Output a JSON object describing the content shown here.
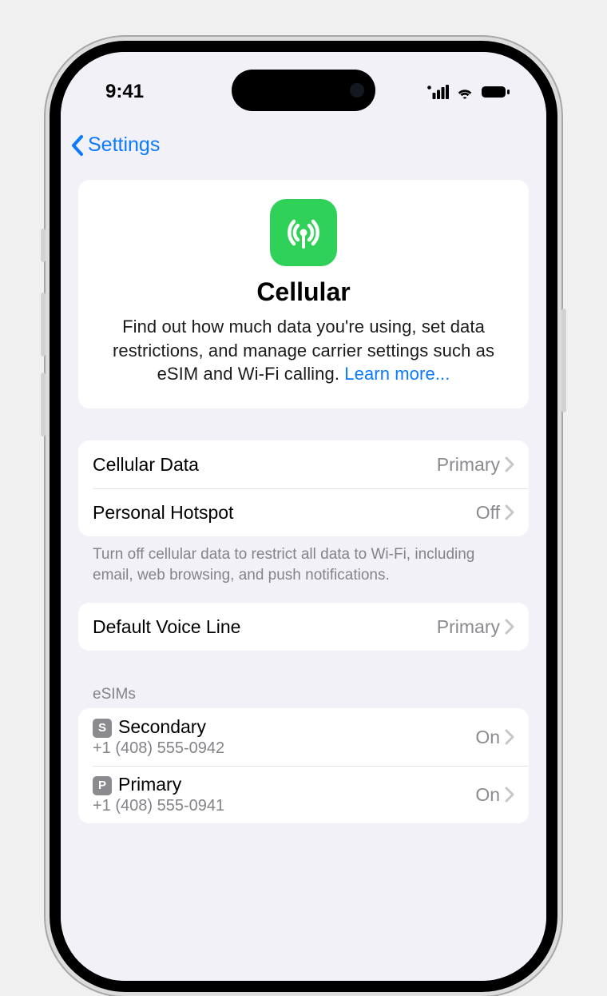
{
  "status": {
    "time": "9:41"
  },
  "nav": {
    "back_label": "Settings"
  },
  "hero": {
    "title": "Cellular",
    "description": "Find out how much data you're using, set data restrictions, and manage carrier settings such as eSIM and Wi-Fi calling. ",
    "learn_more": "Learn more..."
  },
  "group1": {
    "rows": [
      {
        "label": "Cellular Data",
        "value": "Primary"
      },
      {
        "label": "Personal Hotspot",
        "value": "Off"
      }
    ],
    "footer": "Turn off cellular data to restrict all data to Wi-Fi, including email, web browsing, and push notifications."
  },
  "group2": {
    "rows": [
      {
        "label": "Default Voice Line",
        "value": "Primary"
      }
    ]
  },
  "sims": {
    "header": "eSIMs",
    "items": [
      {
        "badge": "S",
        "name": "Secondary",
        "number": "+1 (408) 555-0942",
        "status": "On"
      },
      {
        "badge": "P",
        "name": "Primary",
        "number": "+1 (408) 555-0941",
        "status": "On"
      }
    ]
  }
}
